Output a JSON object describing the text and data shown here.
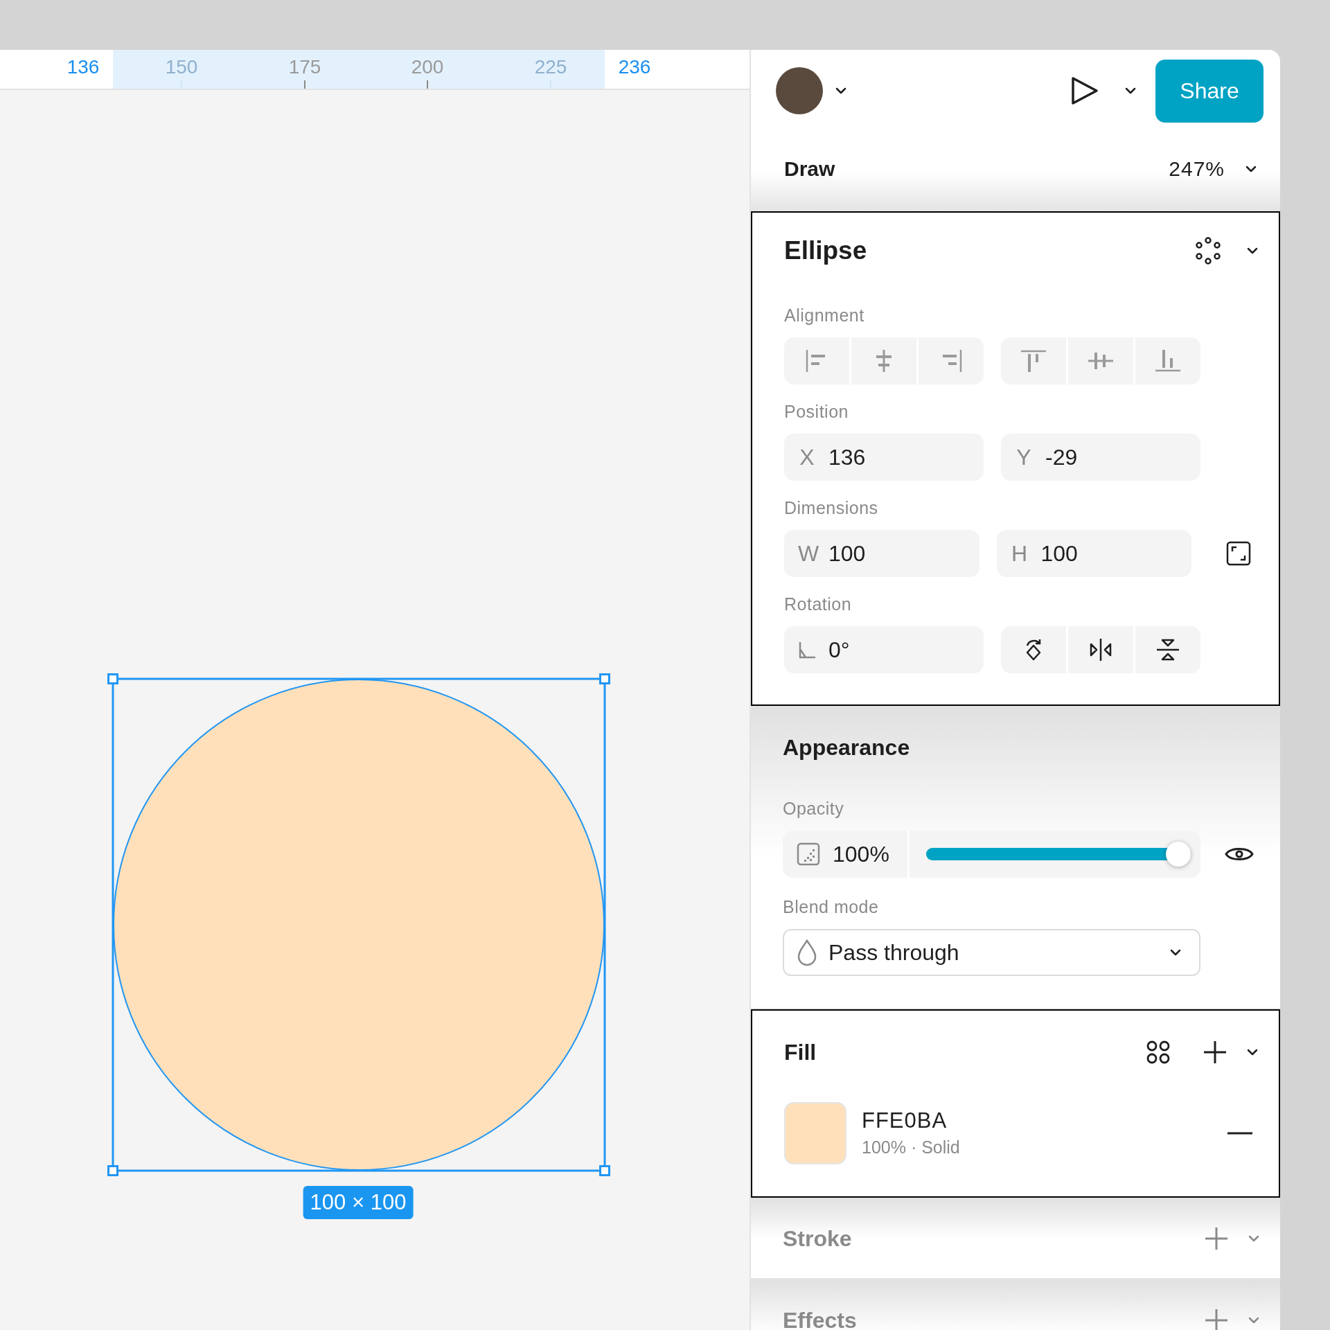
{
  "ruler": {
    "marks": [
      {
        "label": "136",
        "kind": "bound"
      },
      {
        "label": "150",
        "kind": "faint"
      },
      {
        "label": "175",
        "kind": "tick"
      },
      {
        "label": "200",
        "kind": "tick"
      },
      {
        "label": "225",
        "kind": "faint"
      },
      {
        "label": "236",
        "kind": "bound"
      }
    ]
  },
  "canvas": {
    "shape": {
      "kind": "ellipse",
      "color": "#ffe0ba",
      "selected": true,
      "size_label": "100 × 100"
    }
  },
  "header": {
    "share": "Share"
  },
  "zoom_bar": {
    "mode": "Draw",
    "zoom": "247%"
  },
  "layer": {
    "title": "Ellipse",
    "highlighted": true,
    "alignment_label": "Alignment",
    "position_label": "Position",
    "x": {
      "label": "X",
      "value": "136"
    },
    "y": {
      "label": "Y",
      "value": "-29"
    },
    "dimensions_label": "Dimensions",
    "w": {
      "label": "W",
      "value": "100"
    },
    "h": {
      "label": "H",
      "value": "100"
    },
    "rotation_label": "Rotation",
    "rotation": "0°"
  },
  "appearance": {
    "title": "Appearance",
    "highlighted": false,
    "opacity_label": "Opacity",
    "opacity": {
      "reading": "100%",
      "level": 1
    },
    "blend_label": "Blend mode",
    "blend_mode": "Pass through"
  },
  "fill": {
    "title": "Fill",
    "highlighted": true,
    "items": [
      {
        "hex": "FFE0BA",
        "color": "#ffe0ba",
        "detail": "100% · Solid"
      }
    ]
  },
  "stroke": {
    "title": "Stroke",
    "highlighted": false,
    "enabled": false
  },
  "effects": {
    "title": "Effects",
    "highlighted": false,
    "enabled": false
  }
}
